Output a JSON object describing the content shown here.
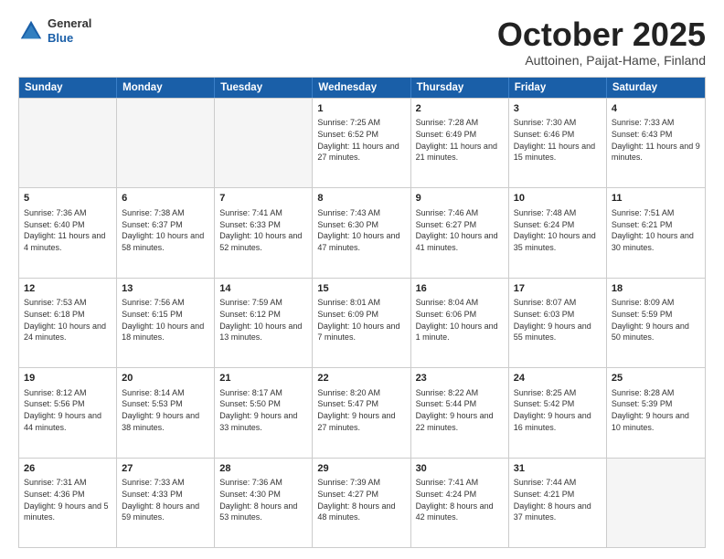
{
  "header": {
    "logo_line1": "General",
    "logo_line2": "Blue",
    "month": "October 2025",
    "location": "Auttoinen, Paijat-Hame, Finland"
  },
  "days_of_week": [
    "Sunday",
    "Monday",
    "Tuesday",
    "Wednesday",
    "Thursday",
    "Friday",
    "Saturday"
  ],
  "weeks": [
    [
      {
        "day": "",
        "info": ""
      },
      {
        "day": "",
        "info": ""
      },
      {
        "day": "",
        "info": ""
      },
      {
        "day": "1",
        "info": "Sunrise: 7:25 AM\nSunset: 6:52 PM\nDaylight: 11 hours\nand 27 minutes."
      },
      {
        "day": "2",
        "info": "Sunrise: 7:28 AM\nSunset: 6:49 PM\nDaylight: 11 hours\nand 21 minutes."
      },
      {
        "day": "3",
        "info": "Sunrise: 7:30 AM\nSunset: 6:46 PM\nDaylight: 11 hours\nand 15 minutes."
      },
      {
        "day": "4",
        "info": "Sunrise: 7:33 AM\nSunset: 6:43 PM\nDaylight: 11 hours\nand 9 minutes."
      }
    ],
    [
      {
        "day": "5",
        "info": "Sunrise: 7:36 AM\nSunset: 6:40 PM\nDaylight: 11 hours\nand 4 minutes."
      },
      {
        "day": "6",
        "info": "Sunrise: 7:38 AM\nSunset: 6:37 PM\nDaylight: 10 hours\nand 58 minutes."
      },
      {
        "day": "7",
        "info": "Sunrise: 7:41 AM\nSunset: 6:33 PM\nDaylight: 10 hours\nand 52 minutes."
      },
      {
        "day": "8",
        "info": "Sunrise: 7:43 AM\nSunset: 6:30 PM\nDaylight: 10 hours\nand 47 minutes."
      },
      {
        "day": "9",
        "info": "Sunrise: 7:46 AM\nSunset: 6:27 PM\nDaylight: 10 hours\nand 41 minutes."
      },
      {
        "day": "10",
        "info": "Sunrise: 7:48 AM\nSunset: 6:24 PM\nDaylight: 10 hours\nand 35 minutes."
      },
      {
        "day": "11",
        "info": "Sunrise: 7:51 AM\nSunset: 6:21 PM\nDaylight: 10 hours\nand 30 minutes."
      }
    ],
    [
      {
        "day": "12",
        "info": "Sunrise: 7:53 AM\nSunset: 6:18 PM\nDaylight: 10 hours\nand 24 minutes."
      },
      {
        "day": "13",
        "info": "Sunrise: 7:56 AM\nSunset: 6:15 PM\nDaylight: 10 hours\nand 18 minutes."
      },
      {
        "day": "14",
        "info": "Sunrise: 7:59 AM\nSunset: 6:12 PM\nDaylight: 10 hours\nand 13 minutes."
      },
      {
        "day": "15",
        "info": "Sunrise: 8:01 AM\nSunset: 6:09 PM\nDaylight: 10 hours\nand 7 minutes."
      },
      {
        "day": "16",
        "info": "Sunrise: 8:04 AM\nSunset: 6:06 PM\nDaylight: 10 hours\nand 1 minute."
      },
      {
        "day": "17",
        "info": "Sunrise: 8:07 AM\nSunset: 6:03 PM\nDaylight: 9 hours\nand 55 minutes."
      },
      {
        "day": "18",
        "info": "Sunrise: 8:09 AM\nSunset: 5:59 PM\nDaylight: 9 hours\nand 50 minutes."
      }
    ],
    [
      {
        "day": "19",
        "info": "Sunrise: 8:12 AM\nSunset: 5:56 PM\nDaylight: 9 hours\nand 44 minutes."
      },
      {
        "day": "20",
        "info": "Sunrise: 8:14 AM\nSunset: 5:53 PM\nDaylight: 9 hours\nand 38 minutes."
      },
      {
        "day": "21",
        "info": "Sunrise: 8:17 AM\nSunset: 5:50 PM\nDaylight: 9 hours\nand 33 minutes."
      },
      {
        "day": "22",
        "info": "Sunrise: 8:20 AM\nSunset: 5:47 PM\nDaylight: 9 hours\nand 27 minutes."
      },
      {
        "day": "23",
        "info": "Sunrise: 8:22 AM\nSunset: 5:44 PM\nDaylight: 9 hours\nand 22 minutes."
      },
      {
        "day": "24",
        "info": "Sunrise: 8:25 AM\nSunset: 5:42 PM\nDaylight: 9 hours\nand 16 minutes."
      },
      {
        "day": "25",
        "info": "Sunrise: 8:28 AM\nSunset: 5:39 PM\nDaylight: 9 hours\nand 10 minutes."
      }
    ],
    [
      {
        "day": "26",
        "info": "Sunrise: 7:31 AM\nSunset: 4:36 PM\nDaylight: 9 hours\nand 5 minutes."
      },
      {
        "day": "27",
        "info": "Sunrise: 7:33 AM\nSunset: 4:33 PM\nDaylight: 8 hours\nand 59 minutes."
      },
      {
        "day": "28",
        "info": "Sunrise: 7:36 AM\nSunset: 4:30 PM\nDaylight: 8 hours\nand 53 minutes."
      },
      {
        "day": "29",
        "info": "Sunrise: 7:39 AM\nSunset: 4:27 PM\nDaylight: 8 hours\nand 48 minutes."
      },
      {
        "day": "30",
        "info": "Sunrise: 7:41 AM\nSunset: 4:24 PM\nDaylight: 8 hours\nand 42 minutes."
      },
      {
        "day": "31",
        "info": "Sunrise: 7:44 AM\nSunset: 4:21 PM\nDaylight: 8 hours\nand 37 minutes."
      },
      {
        "day": "",
        "info": ""
      }
    ]
  ]
}
